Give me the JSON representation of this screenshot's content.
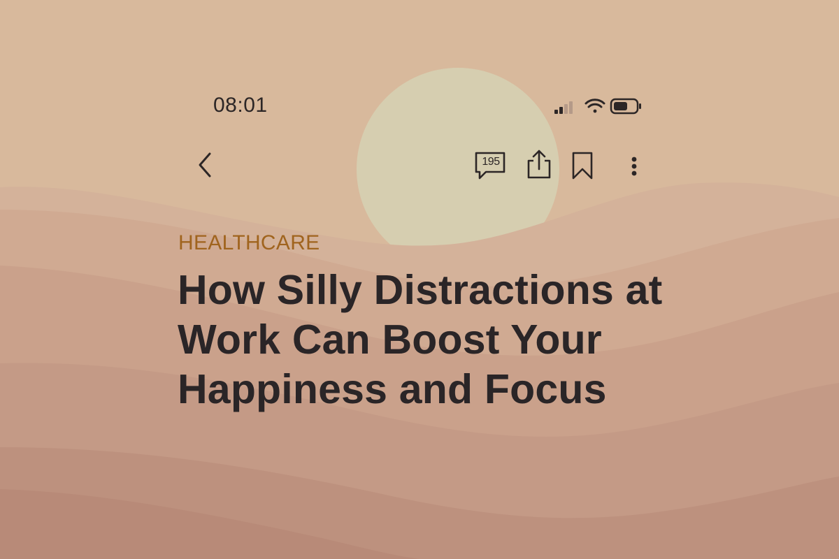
{
  "status_bar": {
    "time": "08:01",
    "signal_icon": "signal-icon",
    "wifi_icon": "wifi-icon",
    "battery_icon": "battery-icon"
  },
  "nav": {
    "back_icon": "chevron-left-icon",
    "comments_count": "195",
    "share_icon": "share-icon",
    "bookmark_icon": "bookmark-icon",
    "more_icon": "more-vertical-icon"
  },
  "article": {
    "category": "HEALTHCARE",
    "title": "How Silly Distractions at Work Can Boost Your Happiness and Focus"
  },
  "colors": {
    "sky": "#d8b99c",
    "sun": "#d5ccae",
    "category": "#a0641e",
    "text": "#2a2527"
  }
}
